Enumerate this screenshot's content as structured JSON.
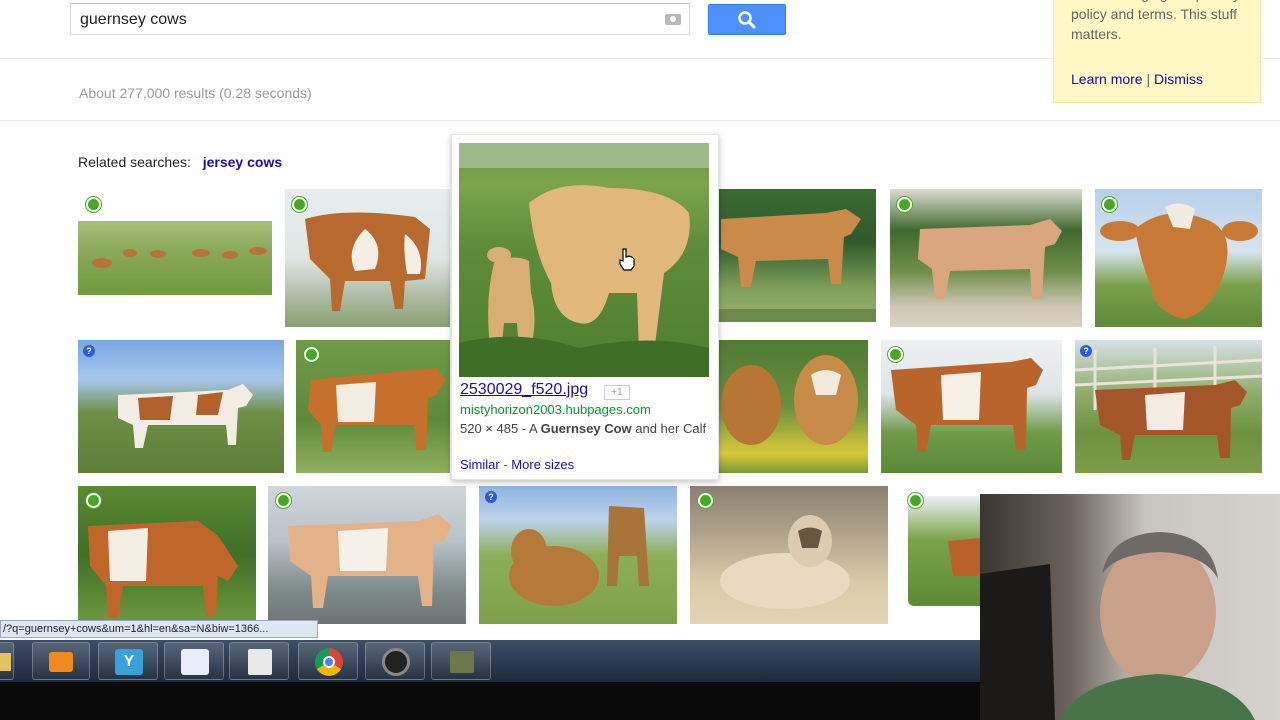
{
  "search": {
    "query": "guernsey cows"
  },
  "results_stats": "About 277,000 results (0.28 seconds)",
  "privacy_notice": {
    "text": "We're changing our privacy policy and terms. This stuff matters.",
    "learn_more": "Learn more",
    "separator": "|",
    "dismiss": "Dismiss"
  },
  "related": {
    "label": "Related searches:",
    "link": "jersey cows"
  },
  "popup": {
    "filename": "2530029_f520.jpg",
    "plus_badge": "+1",
    "domain": "mistyhorizon2003.hubpages.com",
    "size": "520 × 485 - A ",
    "desc_bold": "Guernsey Cow",
    "desc_rest": " and her Calf",
    "similar": "Similar",
    "link_sep": " - ",
    "more_sizes": "More sizes"
  },
  "status_bar": "/?q=guernsey+cows&um=1&hl=en&sa=N&biw=1366...",
  "colors": {
    "link": "#1a0dab",
    "search_button": "#4d90fe",
    "green_url": "#009933",
    "privacy_bg": "#fff8c4"
  },
  "icons": {
    "search": "magnifier-icon",
    "camera": "camera-icon",
    "cursor": "hand-cursor-icon"
  }
}
